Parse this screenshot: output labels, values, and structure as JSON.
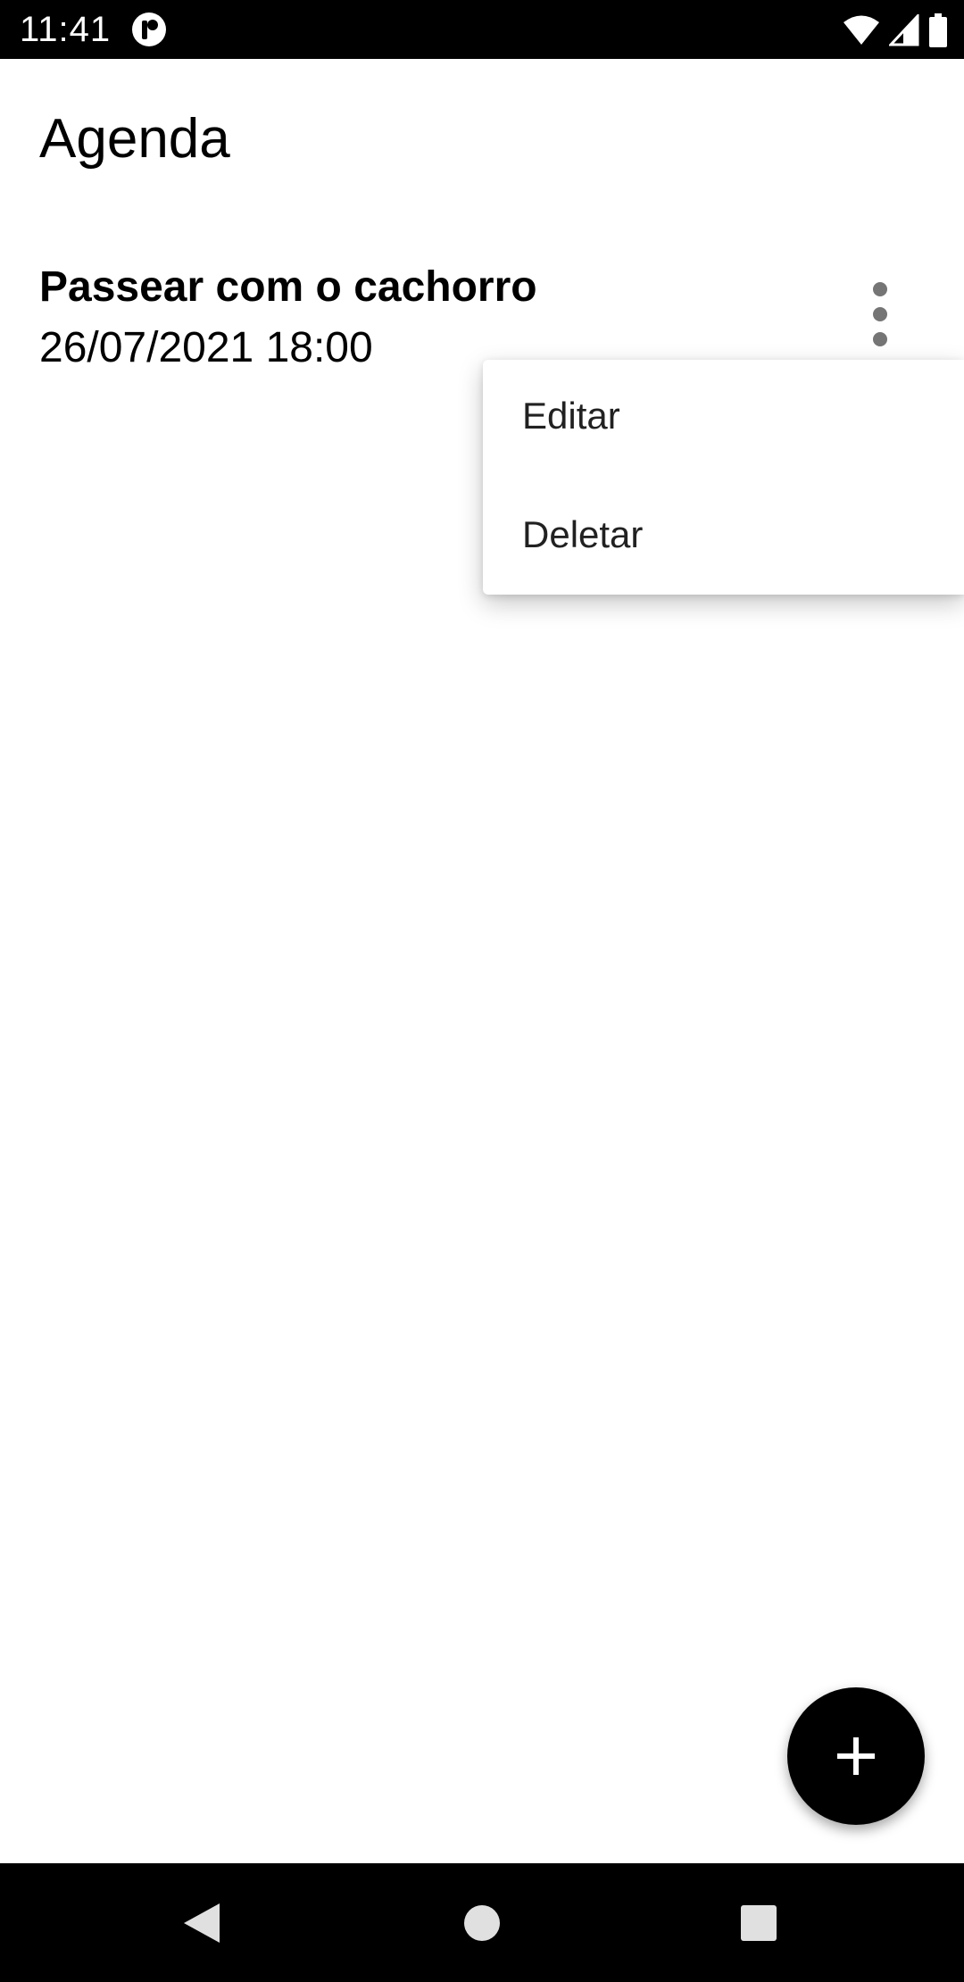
{
  "status_bar": {
    "time": "11:41",
    "icons": [
      "app-notification-icon",
      "wifi-icon",
      "cell-signal-icon",
      "battery-icon"
    ]
  },
  "app_bar": {
    "title": "Agenda"
  },
  "list": {
    "items": [
      {
        "title": "Passear com o cachorro",
        "datetime": "26/07/2021 18:00",
        "menu_icon": "more-vert-icon"
      }
    ]
  },
  "popup_menu": {
    "items": [
      {
        "label": "Editar"
      },
      {
        "label": "Deletar"
      }
    ]
  },
  "fab": {
    "icon": "plus-icon"
  },
  "nav_bar": {
    "buttons": [
      "back-icon",
      "home-icon",
      "recents-icon"
    ]
  },
  "colors": {
    "bars": "#000000",
    "background": "#ffffff",
    "text": "#000000",
    "icon_gray": "#757575"
  }
}
